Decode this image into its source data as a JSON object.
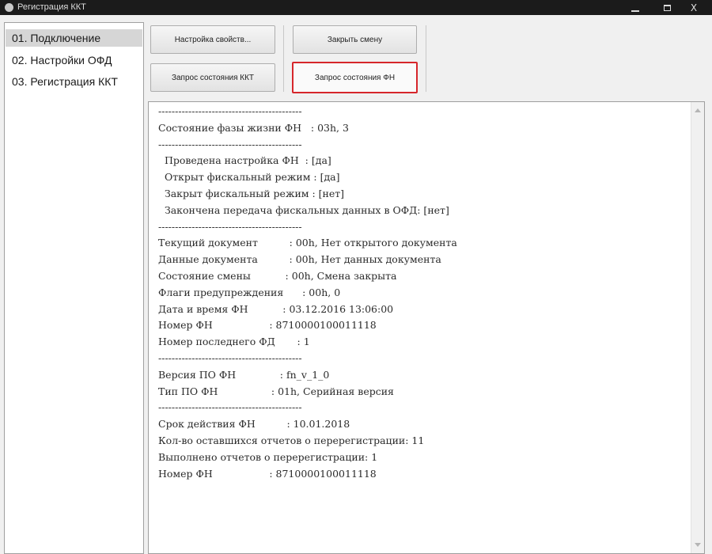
{
  "window": {
    "title": "Регистрация ККТ",
    "min_glyph": "",
    "close_glyph": "X"
  },
  "nav": {
    "items": [
      {
        "label": "01. Подключение",
        "selected": true
      },
      {
        "label": "02. Настройки ОФД",
        "selected": false
      },
      {
        "label": "03. Регистрация ККТ",
        "selected": false
      }
    ]
  },
  "toolbar": {
    "settings_label": "Настройка свойств...",
    "close_shift_label": "Закрыть смену",
    "kkt_status_label": "Запрос состояния ККТ",
    "fn_status_label": "Запрос состояния ФН"
  },
  "output": {
    "lines": [
      "-------------------------------------------",
      "Состояние фазы жизни ФН   : 03h, 3",
      "-------------------------------------------",
      "  Проведена настройка ФН  : [да]",
      "  Открыт фискальный режим : [да]",
      "  Закрыт фискальный режим : [нет]",
      "  Закончена передача фискальных данных в ОФД: [нет]",
      "-------------------------------------------",
      "Текущий документ          : 00h, Нет открытого документа",
      "Данные документа          : 00h, Нет данных документа",
      "Состояние смены           : 00h, Смена закрыта",
      "Флаги предупреждения      : 00h, 0",
      "Дата и время ФН           : 03.12.2016 13:06:00",
      "Номер ФН                  : 8710000100011118",
      "Номер последнего ФД       : 1",
      "-------------------------------------------",
      "Версия ПО ФН              : fn_v_1_0",
      "Тип ПО ФН                 : 01h, Серийная версия",
      "-------------------------------------------",
      "Срок действия ФН          : 10.01.2018",
      "Кол-во оставшихся отчетов о перерегистрации: 11",
      "Выполнено отчетов о перерегистрации: 1",
      "Номер ФН                  : 8710000100011118"
    ]
  }
}
